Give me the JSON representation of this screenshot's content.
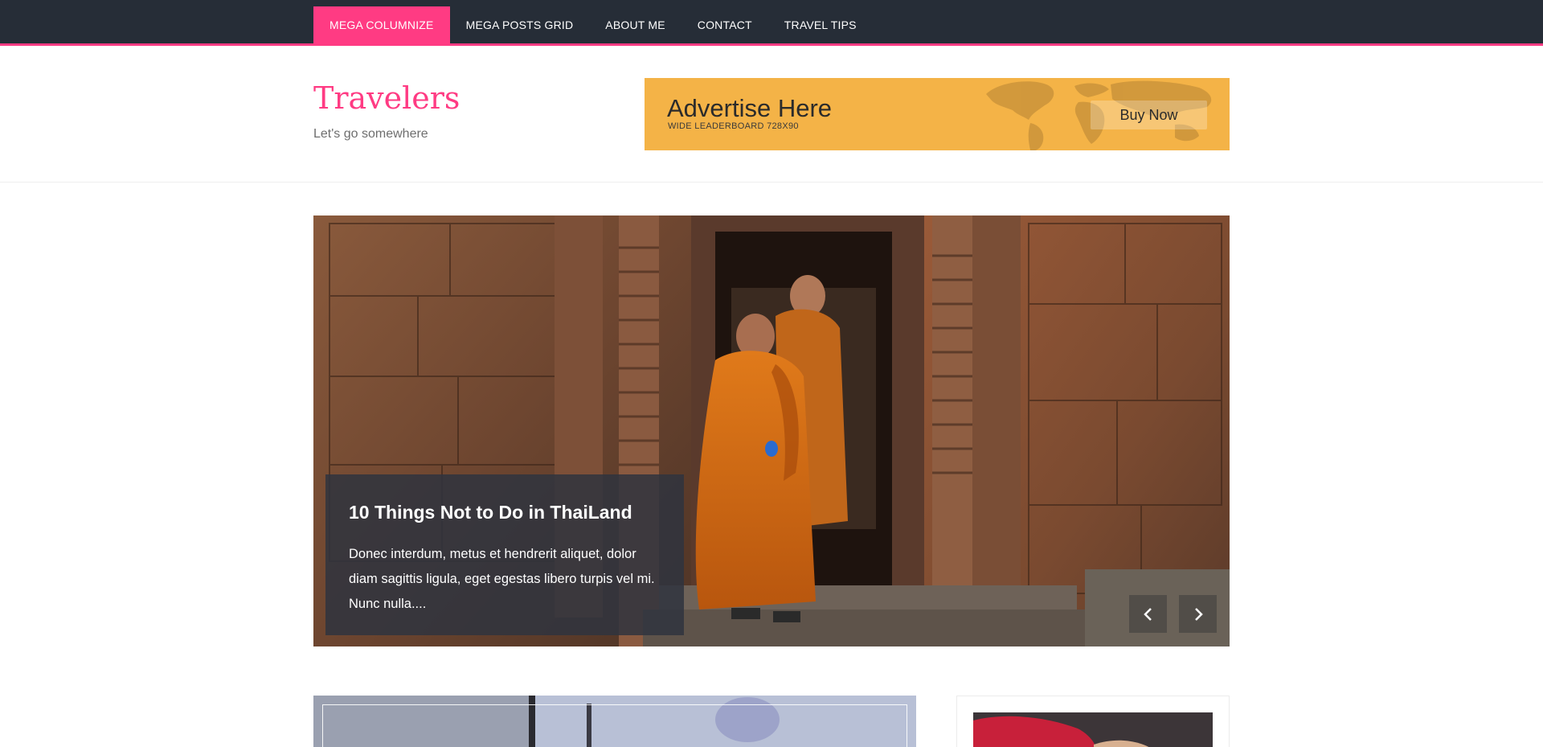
{
  "nav": {
    "items": [
      {
        "label": "MEGA COLUMNIZE",
        "active": true
      },
      {
        "label": "MEGA POSTS GRID",
        "active": false
      },
      {
        "label": "ABOUT ME",
        "active": false
      },
      {
        "label": "CONTACT",
        "active": false
      },
      {
        "label": "TRAVEL TIPS",
        "active": false
      }
    ]
  },
  "header": {
    "title": "Travelers",
    "tagline": "Let's go somewhere"
  },
  "ad": {
    "title": "Advertise Here",
    "subtitle": "WIDE LEADERBOARD 728X90",
    "button": "Buy Now"
  },
  "slider": {
    "title": "10 Things Not to Do in ThaiLand",
    "excerpt": "Donec interdum, metus et hendrerit aliquet, dolor diam sagittis ligula, eget egestas libero turpis vel mi. Nunc nulla....",
    "prev_icon": "chevron-left-icon",
    "next_icon": "chevron-right-icon"
  },
  "colors": {
    "accent": "#ff3b83",
    "nav_bg": "#262d37",
    "ad_bg": "#f4b347"
  }
}
